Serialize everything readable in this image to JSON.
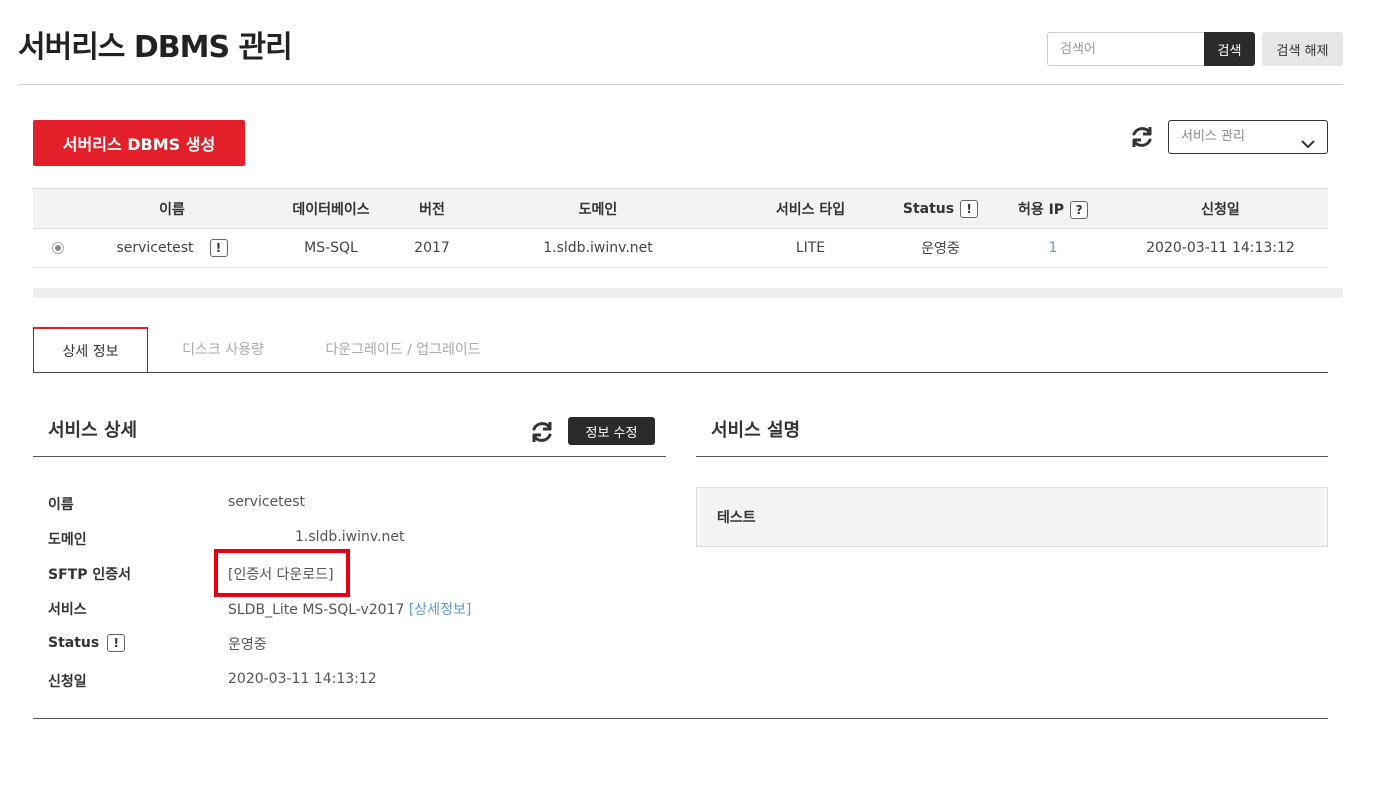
{
  "header": {
    "title": "서버리스 DBMS 관리",
    "search_placeholder": "검색어",
    "search_button": "검색",
    "clear_button": "검색 해제"
  },
  "toolbar": {
    "create_button": "서버리스 DBMS 생성",
    "select_value": "서비스 관리"
  },
  "table": {
    "columns": [
      "이름",
      "데이터베이스",
      "버전",
      "도메인",
      "서비스 타입",
      "Status",
      "허용 IP",
      "신청일"
    ],
    "rows": [
      {
        "name": "servicetest",
        "database": "MS-SQL",
        "version": "2017",
        "domain": "1.sldb.iwinv.net",
        "service_type": "LITE",
        "status": "운영중",
        "allowed_ip": "1",
        "date": "2020-03-11 14:13:12"
      }
    ]
  },
  "tabs": [
    "상세 정보",
    "디스크 사용량",
    "다운그레이드 / 업그레이드"
  ],
  "detail": {
    "title": "서비스 상세",
    "edit_button": "정보 수정",
    "labels": {
      "name": "이름",
      "domain": "도메인",
      "sftp": "SFTP 인증서",
      "service": "서비스",
      "status": "Status",
      "date": "신청일"
    },
    "values": {
      "name": "servicetest",
      "domain": "1.sldb.iwinv.net",
      "sftp_link": "[인증서 다운로드]",
      "service": "SLDB_Lite MS-SQL-v2017",
      "service_link": "[상세정보]",
      "status": "운영중",
      "date": "2020-03-11 14:13:12"
    }
  },
  "description": {
    "title": "서비스 설명",
    "text": "테스트"
  },
  "icons": {
    "status_badge": "!",
    "ip_badge": "?"
  },
  "colors": {
    "accent": "#e3202a",
    "link": "#5b9bd5",
    "dark": "#2b2b2b",
    "highlight": "#e60012"
  }
}
